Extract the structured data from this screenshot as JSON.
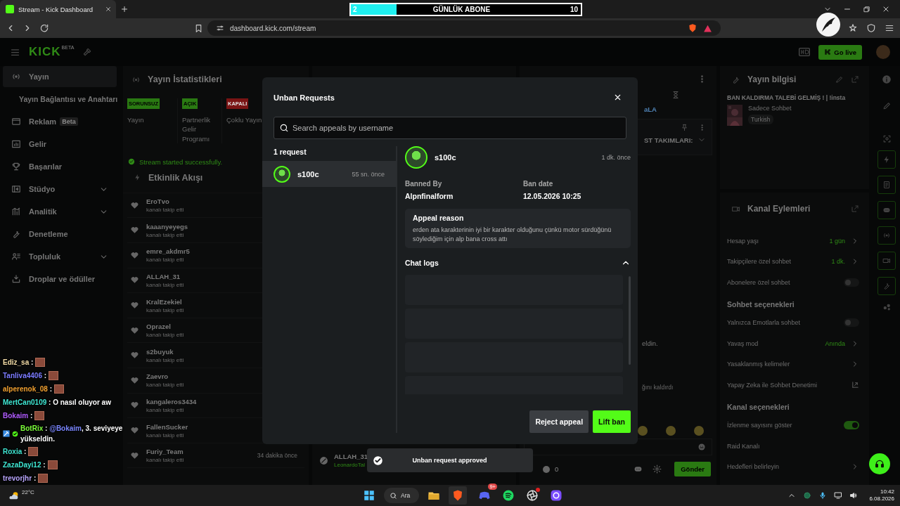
{
  "browser": {
    "tab_title": "Stream - Kick Dashboard",
    "url": "dashboard.kick.com/stream"
  },
  "sub_goal": {
    "current": "2",
    "title": "GÜNLÜK ABONE",
    "target": "10",
    "level": 0.2
  },
  "header": {
    "logo": "KICK",
    "logo_badge": "BETA",
    "go_live": "Go live"
  },
  "sidebar": {
    "items": [
      {
        "label": "Yayın",
        "kind": "item",
        "selected": true
      },
      {
        "label": "Yayın Bağlantısı ve Anahtarı",
        "kind": "subitem",
        "selected": false
      },
      {
        "label": "Reklam",
        "badge": "Beta",
        "kind": "item",
        "selected": false
      },
      {
        "label": "Gelir",
        "kind": "item",
        "selected": false
      },
      {
        "label": "Başarılar",
        "kind": "item",
        "selected": false
      },
      {
        "label": "Stüdyo",
        "kind": "item",
        "selected": false,
        "expandable": true
      },
      {
        "label": "Analitik",
        "kind": "item",
        "selected": false,
        "expandable": true
      },
      {
        "label": "Denetleme",
        "kind": "item",
        "selected": false
      },
      {
        "label": "Topluluk",
        "kind": "item",
        "selected": false,
        "expandable": true
      },
      {
        "label": "Droplar ve ödüller",
        "kind": "item",
        "selected": false
      }
    ]
  },
  "stats": {
    "title": "Yayın İstatistikleri",
    "items": [
      {
        "status": "SORUNSUZ",
        "kind": "ok",
        "label": "Yayın"
      },
      {
        "status": "AÇIK",
        "kind": "ok",
        "label": "Partnerlik Gelir Programı"
      },
      {
        "status": "KAPALI",
        "kind": "off",
        "label": "Çoklu Yayın"
      }
    ],
    "notice": "Stream started successfully."
  },
  "activity": {
    "title": "Etkinlik Akışı",
    "events": [
      {
        "name": "EroTvo",
        "action": "kanalı takip etti"
      },
      {
        "name": "kaaanyeyegs",
        "action": "kanalı takip etti"
      },
      {
        "name": "emre_akdmr5",
        "action": "kanalı takip etti"
      },
      {
        "name": "ALLAH_31",
        "action": "kanalı takip etti"
      },
      {
        "name": "KralEzekiel",
        "action": "kanalı takip etti"
      },
      {
        "name": "Oprazel",
        "action": "kanalı takip etti"
      },
      {
        "name": "s2buyuk",
        "action": "kanalı takip etti"
      },
      {
        "name": "Zaevro",
        "action": "kanalı takip etti"
      },
      {
        "name": "kangaleros3434",
        "action": "kanalı takip etti"
      },
      {
        "name": "FallenSucker",
        "action": "kanalı takip etti"
      },
      {
        "name": "Furiy_Team",
        "action": "kanalı takip etti",
        "time": "34 dakika önce"
      }
    ]
  },
  "moderation_feed": {
    "items": [
      {
        "name": "ALLAH_31",
        "by": "LeonardoTal"
      }
    ]
  },
  "chat": {
    "user_fragment": "aLA",
    "pinned": "ST TAKIMLARI:",
    "messages": [
      {
        "kind": "text",
        "text": "eldin."
      },
      {
        "kind": "system",
        "text": "ğını kaldırdı"
      }
    ],
    "count": "0",
    "send": "Gönder"
  },
  "channel_info": {
    "title": "Yayın bilgisi",
    "stream_title": "BAN KALDIRMA TALEBİ GELMİŞ ! | !insta",
    "category": "Sadece Sohbet",
    "tag": "Turkish"
  },
  "channel_actions": {
    "title": "Kanal Eylemleri",
    "rows": [
      {
        "kind": "value",
        "label": "Hesap yaşı",
        "value": "1 gün"
      },
      {
        "kind": "value",
        "label": "Takipçilere özel sohbet",
        "value": "1 dk."
      },
      {
        "kind": "toggle",
        "label": "Abonelere özel sohbet",
        "on": false
      },
      {
        "kind": "section",
        "label": "Sohbet seçenekleri"
      },
      {
        "kind": "toggle",
        "label": "Yalnızca Emotlarla sohbet",
        "on": false
      },
      {
        "kind": "value",
        "label": "Yavaş mod",
        "value": "Anında"
      },
      {
        "kind": "link",
        "label": "Yasaklanmış kelimeler"
      },
      {
        "kind": "external",
        "label": "Yapay Zeka ile Sohbet Denetimi"
      },
      {
        "kind": "section",
        "label": "Kanal seçenekleri"
      },
      {
        "kind": "toggle",
        "label": "İzlenme sayısını göster",
        "on": true
      },
      {
        "kind": "plain",
        "label": "Raid Kanalı"
      },
      {
        "kind": "link",
        "label": "Hedefleri belirleyin"
      }
    ]
  },
  "unban_modal": {
    "title": "Unban Requests",
    "search": {
      "placeholder": "Search appeals by username"
    },
    "count": "1 request",
    "requests": [
      {
        "username": "s100c",
        "time": "55 sn. önce",
        "selected": true
      }
    ],
    "detail": {
      "username": "s100c",
      "time": "1 dk. önce",
      "banned_by_label": "Banned By",
      "banned_by": "Alpnfinalform",
      "ban_date_label": "Ban date",
      "ban_date": "12.05.2026 10:25",
      "appeal_title": "Appeal reason",
      "appeal_reason": "erden ata karakterinin iyi bir karakter olduğunu çünkü motor sürdüğünü söylediğim için alp bana cross attı",
      "chat_logs_title": "Chat logs",
      "chat_logs_expanded": true
    },
    "buttons": [
      {
        "label": "Reject appeal",
        "kind": "secondary"
      },
      {
        "label": "Lift ban",
        "kind": "primary"
      }
    ]
  },
  "toast": {
    "message": "Unban request approved"
  },
  "stream_chat_overlay": {
    "messages": [
      {
        "user": "Ediz_sa",
        "sep": ":",
        "color": "#f3dca6",
        "emote": true
      },
      {
        "user": "Tanliva4406",
        "sep": ":",
        "color": "#7b7bff",
        "emote": true
      },
      {
        "user": "alperenok_08",
        "sep": ":",
        "color": "#f0a030",
        "emote": true
      },
      {
        "user": "MertCan0109",
        "sep": ":",
        "color": "#3ee6d2",
        "text": "O nasıl oluyor aw"
      },
      {
        "user": "Bokaim",
        "sep": ":",
        "color": "#b05cff",
        "emote": true
      },
      {
        "user": "BotRix",
        "sep": ":",
        "color": "#7cff3a",
        "bot": true,
        "mention": "@Bokaim",
        "text": ", 3. seviyeye yükseldin."
      },
      {
        "user": "Roxia",
        "sep": ":",
        "color": "#3ee6d2",
        "emote": true
      },
      {
        "user": "ZazaDayi12",
        "sep": ":",
        "color": "#3ee6d2",
        "emote": true
      },
      {
        "user": "trevorjhr",
        "sep": ":",
        "color": "#b9a6ff",
        "emote": true
      }
    ]
  },
  "taskbar": {
    "weather": "22°C",
    "search": "Ara",
    "discord_badge": "9+",
    "time": "10:42",
    "date": "6.08.2026"
  }
}
